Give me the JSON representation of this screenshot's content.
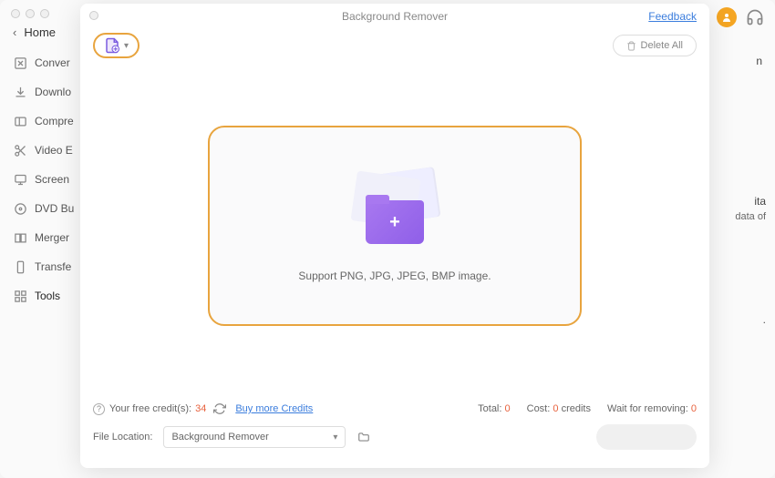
{
  "sidebar": {
    "back_label": "Home",
    "items": [
      {
        "label": "Conver"
      },
      {
        "label": "Downlo"
      },
      {
        "label": "Compre"
      },
      {
        "label": "Video E"
      },
      {
        "label": "Screen"
      },
      {
        "label": "DVD Bu"
      },
      {
        "label": "Merger"
      },
      {
        "label": "Transfe"
      },
      {
        "label": "Tools"
      }
    ]
  },
  "modal": {
    "title": "Background Remover",
    "feedback": "Feedback",
    "delete_all": "Delete All",
    "drop_text": "Support PNG, JPG, JPEG, BMP image.",
    "credits": {
      "label": "Your free credit(s):",
      "count": "34",
      "buy": "Buy more Credits"
    },
    "stats": {
      "total_label": "Total:",
      "total_value": "0",
      "cost_label": "Cost:",
      "cost_value": "0",
      "cost_unit": "credits",
      "wait_label": "Wait for removing:",
      "wait_value": "0"
    },
    "location": {
      "label": "File Location:",
      "value": "Background Remover"
    }
  },
  "right_panel": {
    "l1": "n",
    "l2": "ita",
    "l3": "data of",
    "l4": "."
  }
}
